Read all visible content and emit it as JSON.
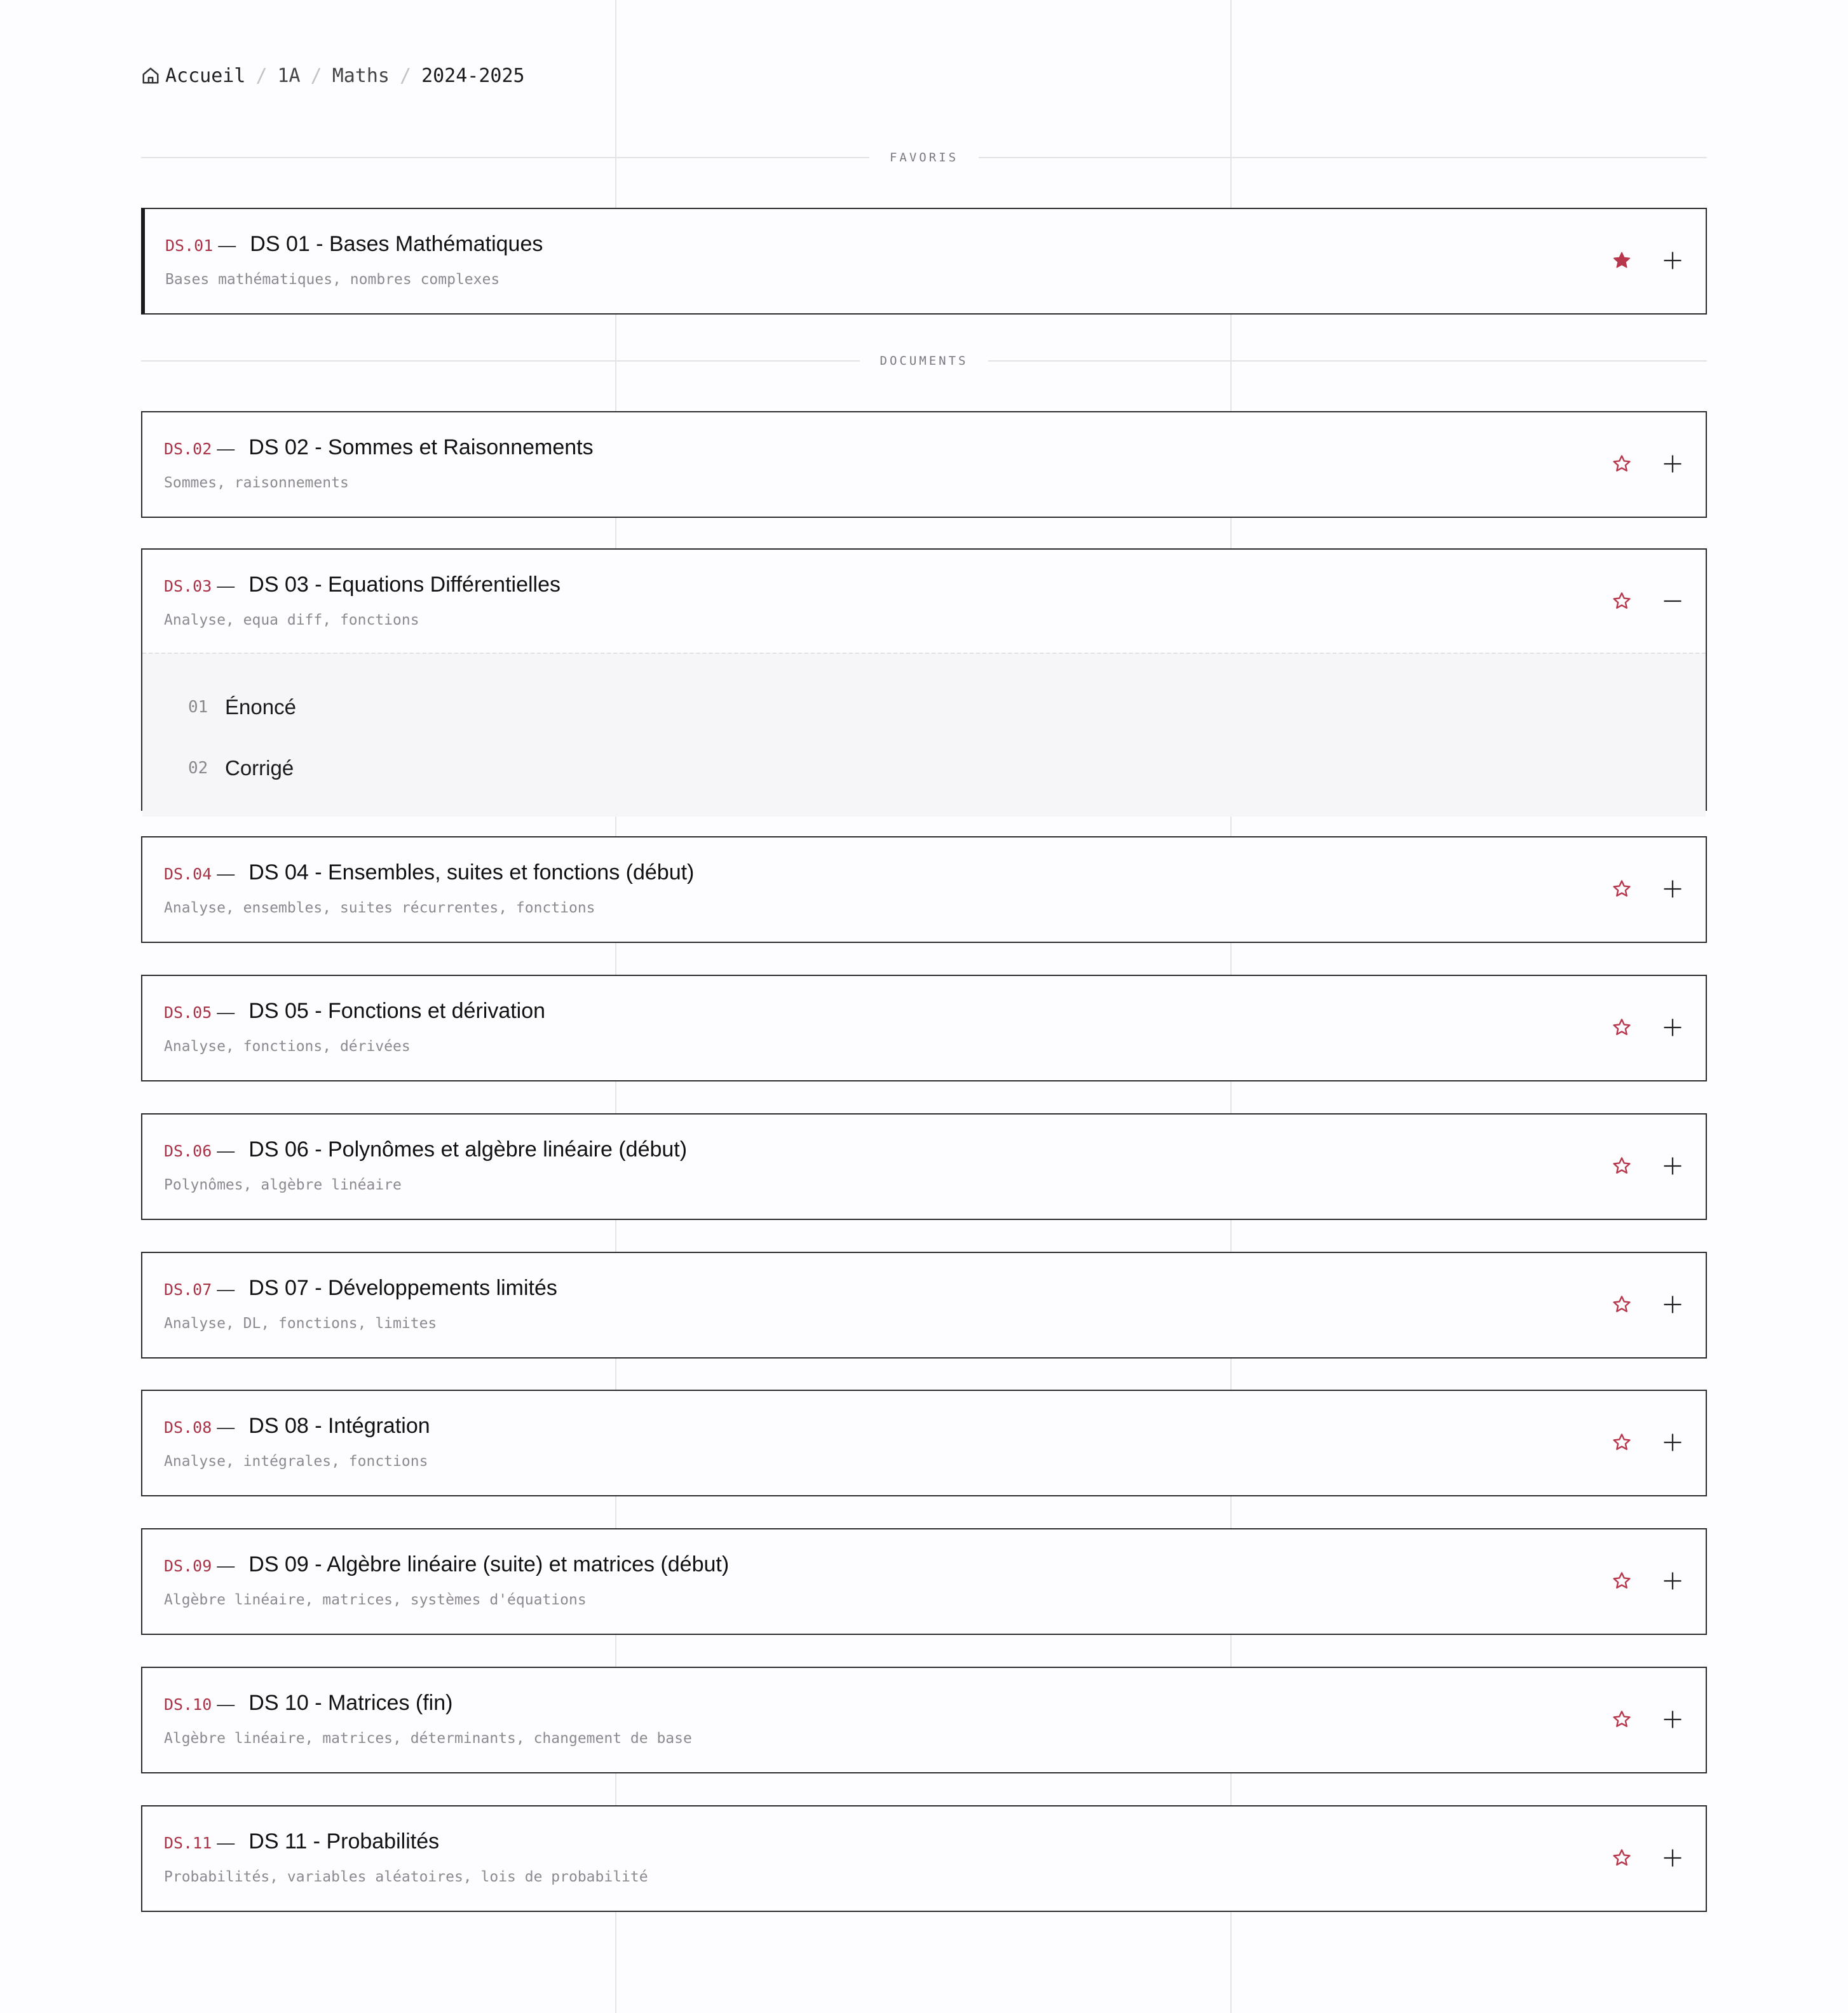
{
  "breadcrumb": {
    "items": [
      "Accueil",
      "1A",
      "Maths",
      "2024-2025"
    ],
    "separator": "/"
  },
  "sections": {
    "favorites_label": "FAVORIS",
    "documents_label": "DOCUMENTS"
  },
  "colors": {
    "accent": "#a83246",
    "border": "#2a2a2a",
    "background": "#fdfcfe",
    "expanded_background": "#f6f5f7"
  },
  "favorites": [
    {
      "code": "DS.01",
      "dash": "—",
      "title": "DS 01 - Bases Mathématiques",
      "tags": "Bases mathématiques, nombres complexes",
      "starred": true,
      "expanded": false
    }
  ],
  "documents": [
    {
      "code": "DS.02",
      "dash": "—",
      "title": "DS 02 - Sommes et Raisonnements",
      "tags": "Sommes, raisonnements",
      "starred": false,
      "expanded": false
    },
    {
      "code": "DS.03",
      "dash": "—",
      "title": "DS 03 - Equations Différentielles",
      "tags": "Analyse, equa diff, fonctions",
      "starred": false,
      "expanded": true,
      "files": [
        {
          "num": "01",
          "label": "Énoncé"
        },
        {
          "num": "02",
          "label": "Corrigé"
        }
      ]
    },
    {
      "code": "DS.04",
      "dash": "—",
      "title": "DS 04 - Ensembles, suites et fonctions (début)",
      "tags": "Analyse, ensembles, suites récurrentes, fonctions",
      "starred": false,
      "expanded": false
    },
    {
      "code": "DS.05",
      "dash": "—",
      "title": "DS 05 - Fonctions et dérivation",
      "tags": "Analyse, fonctions, dérivées",
      "starred": false,
      "expanded": false
    },
    {
      "code": "DS.06",
      "dash": "—",
      "title": "DS 06 - Polynômes et algèbre linéaire (début)",
      "tags": "Polynômes, algèbre linéaire",
      "starred": false,
      "expanded": false
    },
    {
      "code": "DS.07",
      "dash": "—",
      "title": "DS 07 - Développements limités",
      "tags": "Analyse, DL, fonctions, limites",
      "starred": false,
      "expanded": false
    },
    {
      "code": "DS.08",
      "dash": "—",
      "title": "DS 08 - Intégration",
      "tags": "Analyse, intégrales, fonctions",
      "starred": false,
      "expanded": false
    },
    {
      "code": "DS.09",
      "dash": "—",
      "title": "DS 09 - Algèbre linéaire (suite) et matrices (début)",
      "tags": "Algèbre linéaire, matrices, systèmes d'équations",
      "starred": false,
      "expanded": false
    },
    {
      "code": "DS.10",
      "dash": "—",
      "title": "DS 10 - Matrices (fin)",
      "tags": "Algèbre linéaire, matrices, déterminants, changement de base",
      "starred": false,
      "expanded": false
    },
    {
      "code": "DS.11",
      "dash": "—",
      "title": "DS 11 - Probabilités",
      "tags": "Probabilités, variables aléatoires, lois de probabilité",
      "starred": false,
      "expanded": false
    }
  ]
}
